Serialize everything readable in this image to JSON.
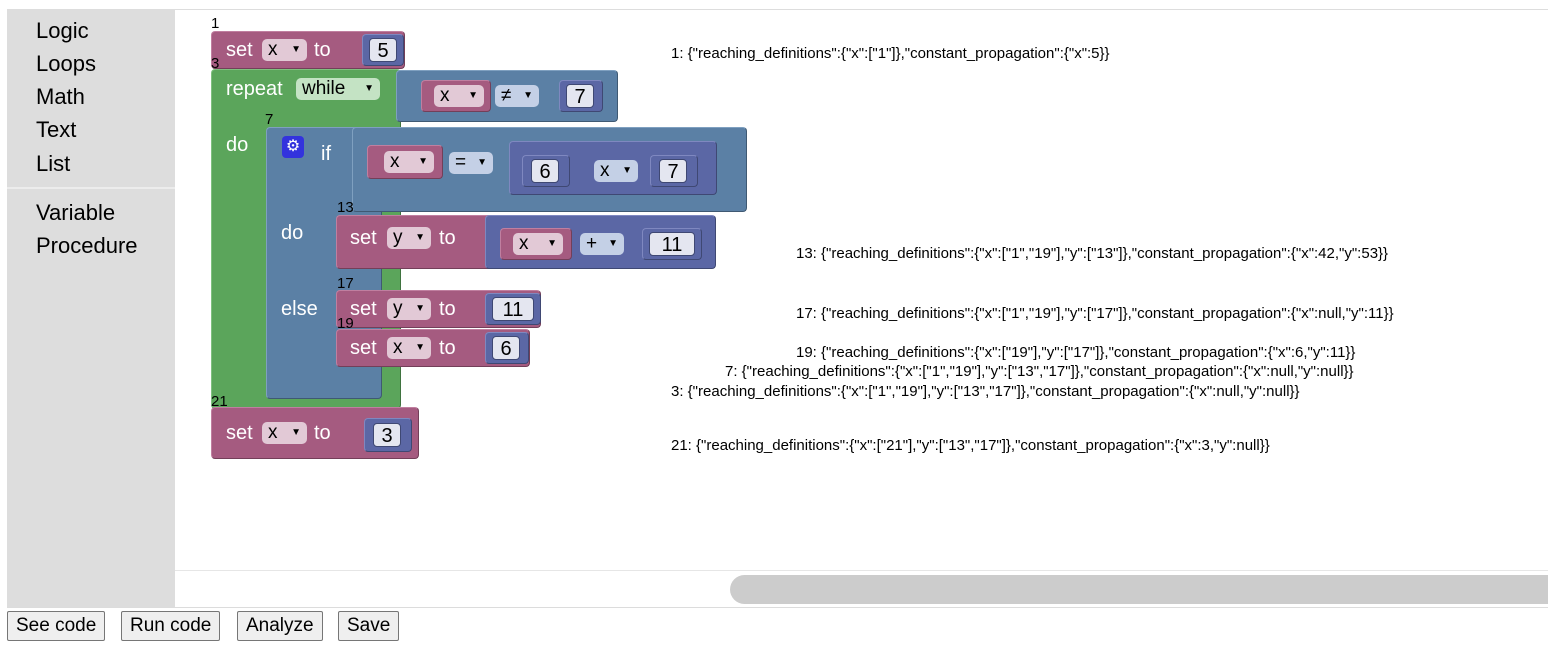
{
  "toolbox": {
    "categories": [
      "Logic",
      "Loops",
      "Math",
      "Text",
      "List"
    ],
    "categories2": [
      "Variable",
      "Procedure"
    ]
  },
  "blocks": {
    "b1": {
      "num": "1",
      "set": "set",
      "var": "x",
      "to": "to",
      "value": "5"
    },
    "b3": {
      "num": "3",
      "repeat": "repeat",
      "mode": "while",
      "do": "do",
      "cond": {
        "var": "x",
        "op": "≠",
        "value": "7"
      }
    },
    "b7": {
      "num": "7",
      "if": "if",
      "do": "do",
      "else": "else",
      "cond": {
        "var": "x",
        "op": "=",
        "a": "6",
        "mid": "x",
        "b": "7"
      }
    },
    "b13": {
      "num": "13",
      "set": "set",
      "var": "y",
      "to": "to",
      "a_var": "x",
      "op": "+",
      "value": "11"
    },
    "b17": {
      "num": "17",
      "set": "set",
      "var": "y",
      "to": "to",
      "value": "11"
    },
    "b19": {
      "num": "19",
      "set": "set",
      "var": "x",
      "to": "to",
      "value": "6"
    },
    "b21": {
      "num": "21",
      "set": "set",
      "var": "x",
      "to": "to",
      "value": "3"
    }
  },
  "analysis": {
    "a1": "1: {\"reaching_definitions\":{\"x\":[\"1\"]},\"constant_propagation\":{\"x\":5}}",
    "a13": "13: {\"reaching_definitions\":{\"x\":[\"1\",\"19\"],\"y\":[\"13\"]},\"constant_propagation\":{\"x\":42,\"y\":53}}",
    "a17": "17: {\"reaching_definitions\":{\"x\":[\"1\",\"19\"],\"y\":[\"17\"]},\"constant_propagation\":{\"x\":null,\"y\":11}}",
    "a19": "19: {\"reaching_definitions\":{\"x\":[\"19\"],\"y\":[\"17\"]},\"constant_propagation\":{\"x\":6,\"y\":11}}",
    "a7": "7: {\"reaching_definitions\":{\"x\":[\"1\",\"19\"],\"y\":[\"13\",\"17\"]},\"constant_propagation\":{\"x\":null,\"y\":null}}",
    "a3": "3: {\"reaching_definitions\":{\"x\":[\"1\",\"19\"],\"y\":[\"13\",\"17\"]},\"constant_propagation\":{\"x\":null,\"y\":null}}",
    "a21": "21: {\"reaching_definitions\":{\"x\":[\"21\"],\"y\":[\"13\",\"17\"]},\"constant_propagation\":{\"x\":3,\"y\":null}}"
  },
  "buttons": {
    "see_code": "See code",
    "run_code": "Run code",
    "analyze": "Analyze",
    "save": "Save"
  },
  "colors": {
    "variable": "#a55b80",
    "loop": "#5ba55b",
    "logic": "#5b80a5",
    "math": "#5b67a5",
    "toolbox": "#dddddd"
  }
}
